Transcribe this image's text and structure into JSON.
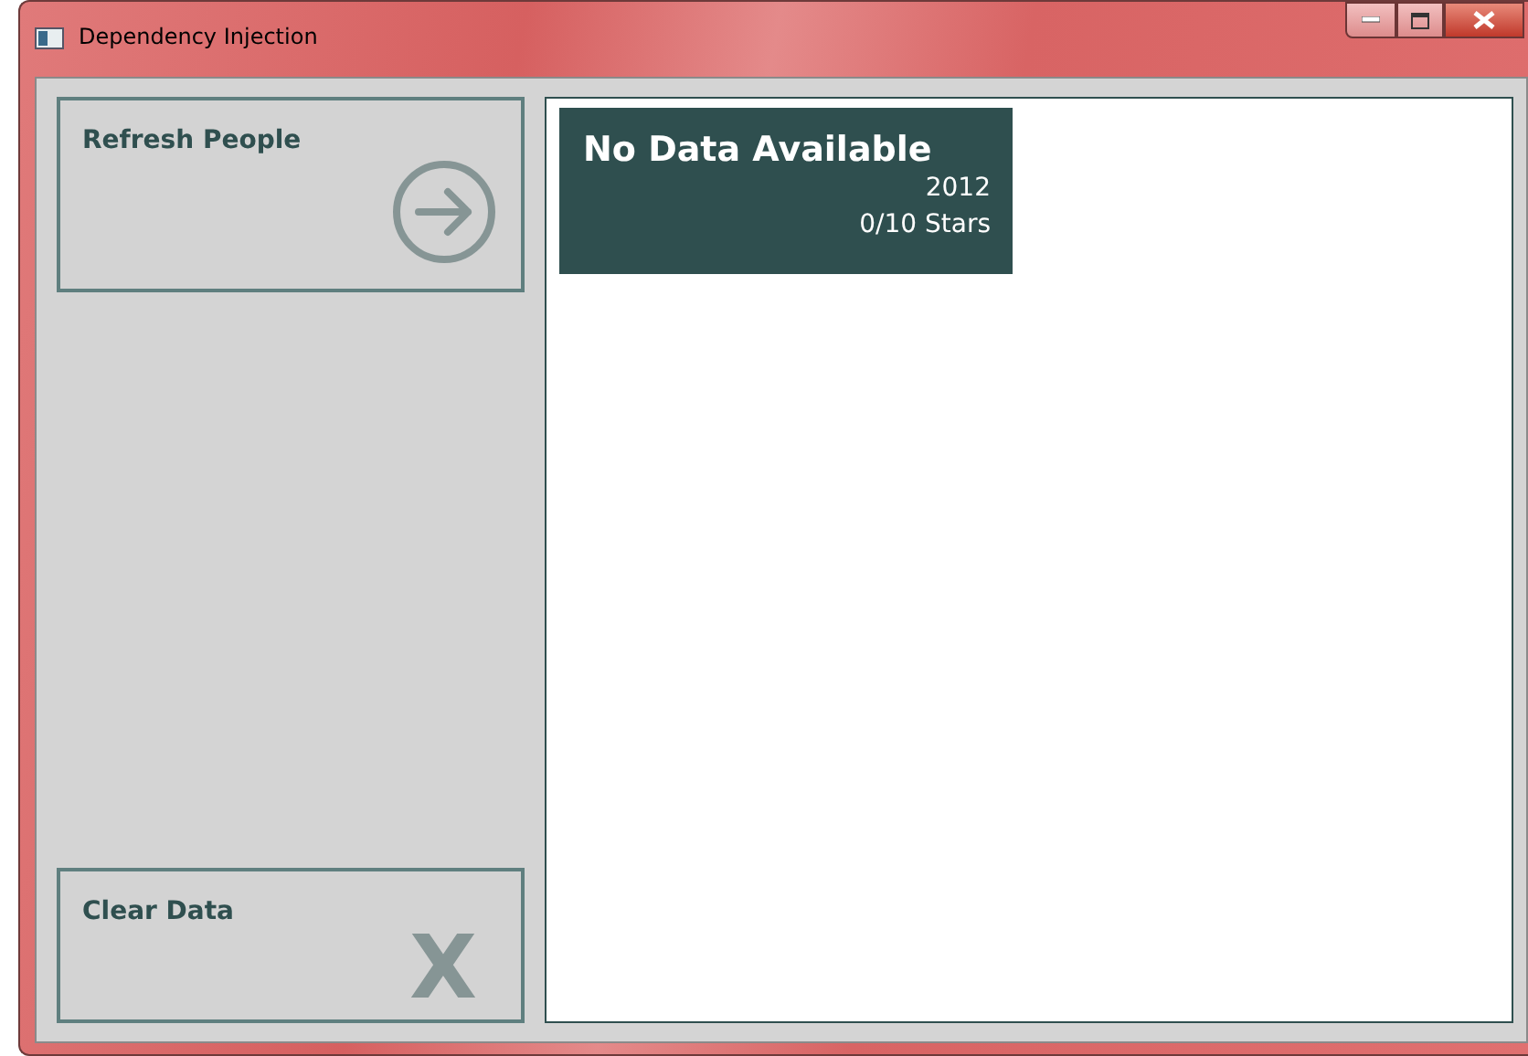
{
  "window": {
    "title": "Dependency Injection"
  },
  "actions": [
    {
      "kind": "refresh",
      "label": "Refresh People"
    },
    {
      "kind": "clear",
      "label": "Clear Data",
      "glyph": "X"
    }
  ],
  "items": [
    {
      "name": "No Data Available",
      "year": "2012",
      "rating": "0/10 Stars"
    }
  ]
}
